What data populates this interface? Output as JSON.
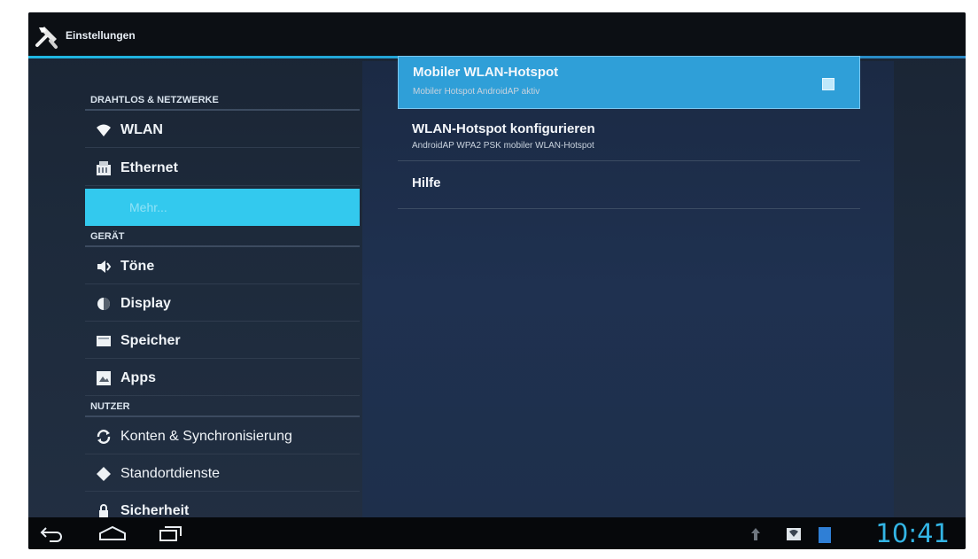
{
  "action_bar": {
    "title": "Einstellungen",
    "icon": "tools-icon"
  },
  "sidebar": {
    "sections": [
      {
        "header": "DRAHTLOS & NETZWERKE",
        "items": [
          {
            "label": "WLAN",
            "icon": "wifi-icon"
          },
          {
            "label": "Ethernet",
            "icon": "ethernet-icon"
          },
          {
            "label": "Mehr...",
            "icon": "",
            "active": true
          }
        ]
      },
      {
        "header": "GERÄT",
        "items": [
          {
            "label": "Töne",
            "icon": "speaker-icon"
          },
          {
            "label": "Display",
            "icon": "display-icon"
          },
          {
            "label": "Speicher",
            "icon": "storage-icon"
          },
          {
            "label": "Apps",
            "icon": "apps-icon"
          }
        ]
      },
      {
        "header": "NUTZER",
        "items": [
          {
            "label": "Konten & Synchronisierung",
            "icon": "sync-icon"
          },
          {
            "label": "Standortdienste",
            "icon": "location-icon"
          },
          {
            "label": "Sicherheit",
            "icon": "lock-icon"
          }
        ]
      }
    ]
  },
  "detail": {
    "items": [
      {
        "title": "Mobiler WLAN-Hotspot",
        "summary": "Mobiler Hotspot AndroidAP aktiv",
        "checked": true
      },
      {
        "title": "WLAN-Hotspot konfigurieren",
        "summary": "AndroidAP WPA2 PSK mobiler WLAN-Hotspot"
      },
      {
        "title": "Hilfe",
        "summary": ""
      }
    ]
  },
  "nav_bar": {
    "back": "back-icon",
    "home": "home-icon",
    "recents": "recent-apps-icon"
  },
  "status_bar": {
    "time": "10:41"
  },
  "colors": {
    "accent": "#33b5e5",
    "active_item": "#33c9ee",
    "selected_pref": "#2f9fd8"
  }
}
